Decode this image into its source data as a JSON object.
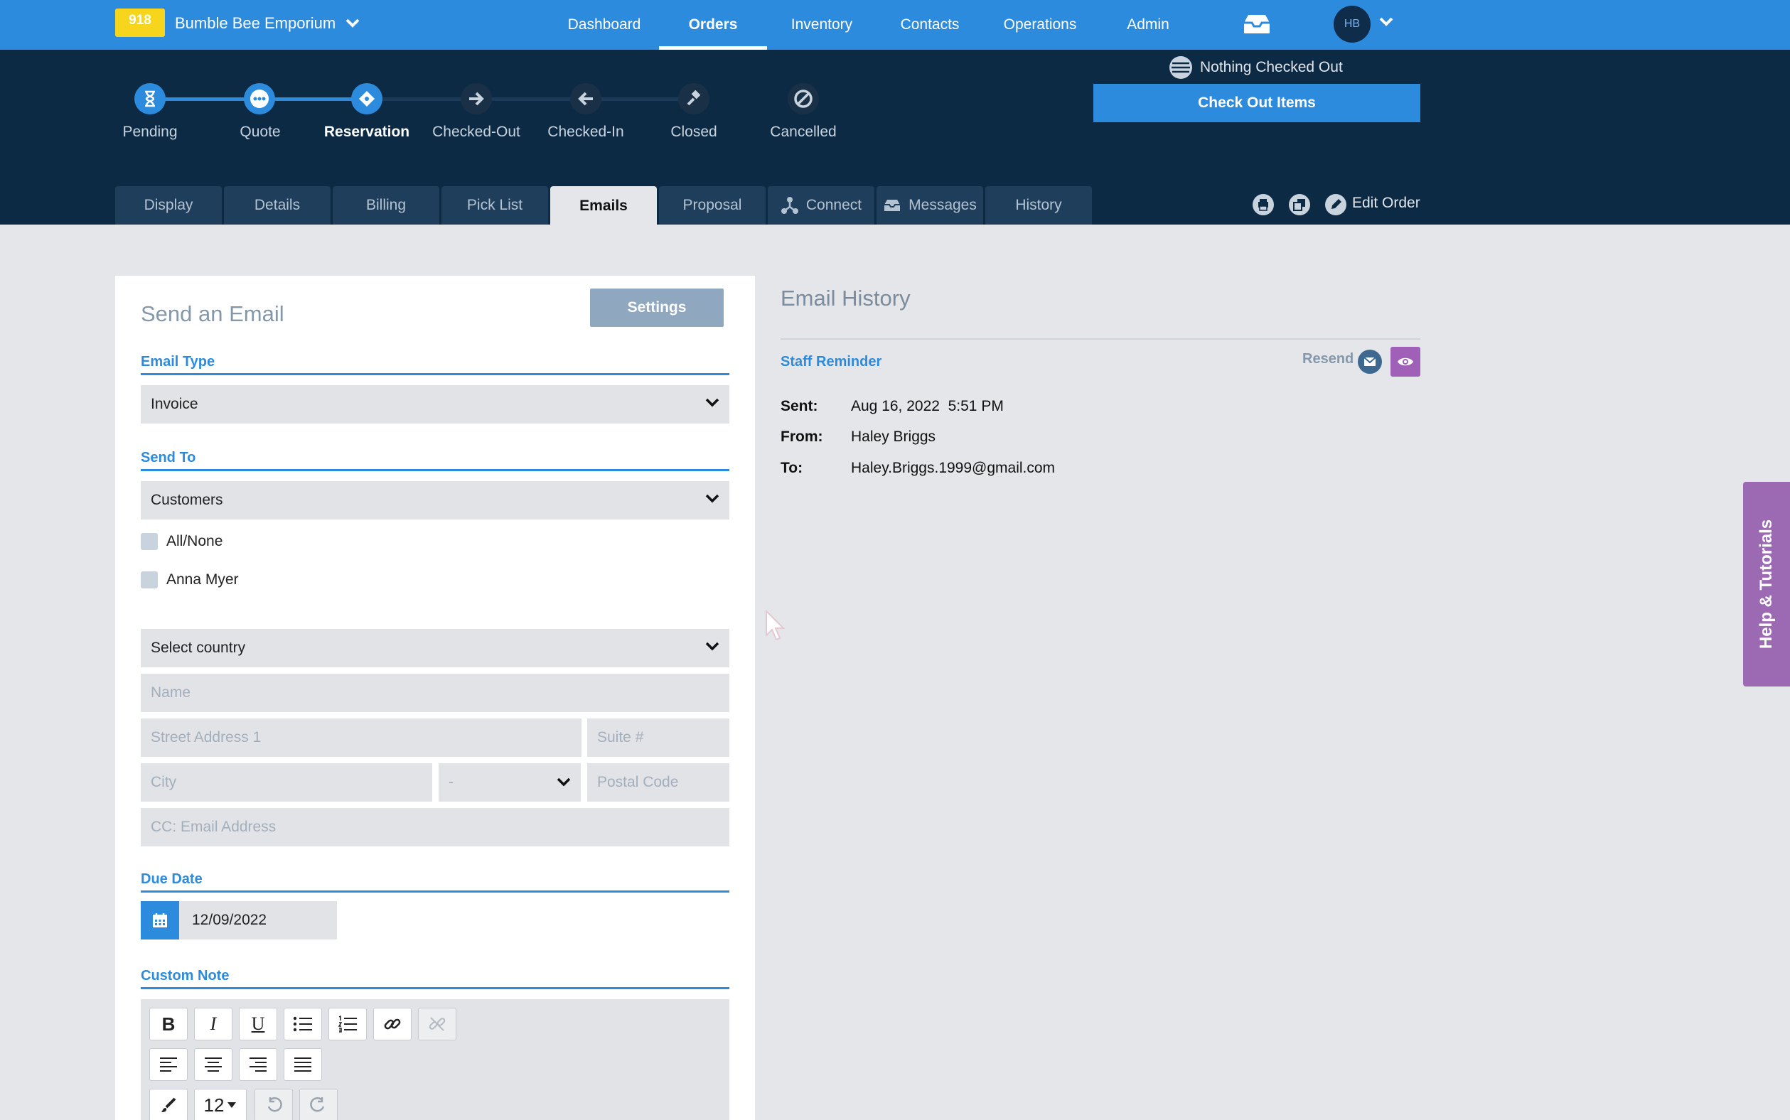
{
  "topbar": {
    "badge": "918",
    "company": "Bumble Bee Emporium",
    "nav": [
      "Dashboard",
      "Orders",
      "Inventory",
      "Contacts",
      "Operations",
      "Admin"
    ],
    "active_nav": "Orders",
    "avatar": "HB"
  },
  "status_steps": [
    "Pending",
    "Quote",
    "Reservation",
    "Checked-Out",
    "Checked-In",
    "Closed",
    "Cancelled"
  ],
  "current_step": "Reservation",
  "checkout": {
    "status": "Nothing Checked Out",
    "button": "Check Out Items"
  },
  "tabs": [
    "Display",
    "Details",
    "Billing",
    "Pick List",
    "Emails",
    "Proposal",
    "Connect",
    "Messages",
    "History"
  ],
  "active_tab": "Emails",
  "edit_order": "Edit Order",
  "send_email": {
    "title": "Send an Email",
    "settings": "Settings",
    "email_type_label": "Email Type",
    "email_type_value": "Invoice",
    "send_to_label": "Send To",
    "send_to_value": "Customers",
    "recipients": [
      "All/None",
      "Anna Myer"
    ],
    "country": "Select country",
    "placeholders": {
      "name": "Name",
      "street": "Street Address 1",
      "suite": "Suite #",
      "city": "City",
      "state": "-",
      "postal": "Postal Code",
      "cc": "CC: Email Address"
    },
    "due_date_label": "Due Date",
    "due_date_value": "12/09/2022",
    "custom_note_label": "Custom Note",
    "font_size": "12"
  },
  "email_history": {
    "title": "Email History",
    "entries": [
      {
        "name": "Staff Reminder",
        "resend": "Resend",
        "sent_label": "Sent:",
        "sent": "Aug 16, 2022  5:51 PM",
        "from_label": "From:",
        "from": "Haley Briggs",
        "to_label": "To:",
        "to": "Haley.Briggs.1999@gmail.com"
      }
    ]
  },
  "help": "Help & Tutorials",
  "colors": {
    "primary": "#2d8bde",
    "dark": "#0d2a45",
    "badge": "#f7d51d",
    "help": "#9c69b3"
  }
}
